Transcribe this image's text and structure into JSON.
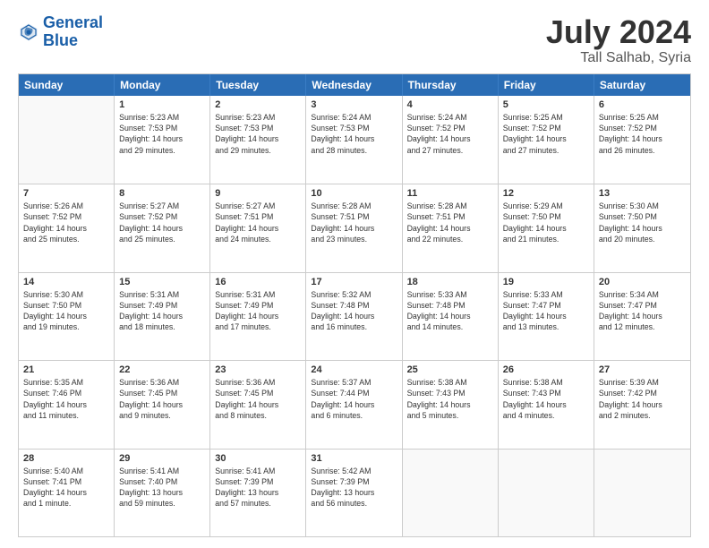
{
  "header": {
    "logo_line1": "General",
    "logo_line2": "Blue",
    "month_year": "July 2024",
    "location": "Tall Salhab, Syria"
  },
  "weekdays": [
    "Sunday",
    "Monday",
    "Tuesday",
    "Wednesday",
    "Thursday",
    "Friday",
    "Saturday"
  ],
  "weeks": [
    [
      {
        "day": "",
        "info": ""
      },
      {
        "day": "1",
        "info": "Sunrise: 5:23 AM\nSunset: 7:53 PM\nDaylight: 14 hours\nand 29 minutes."
      },
      {
        "day": "2",
        "info": "Sunrise: 5:23 AM\nSunset: 7:53 PM\nDaylight: 14 hours\nand 29 minutes."
      },
      {
        "day": "3",
        "info": "Sunrise: 5:24 AM\nSunset: 7:53 PM\nDaylight: 14 hours\nand 28 minutes."
      },
      {
        "day": "4",
        "info": "Sunrise: 5:24 AM\nSunset: 7:52 PM\nDaylight: 14 hours\nand 27 minutes."
      },
      {
        "day": "5",
        "info": "Sunrise: 5:25 AM\nSunset: 7:52 PM\nDaylight: 14 hours\nand 27 minutes."
      },
      {
        "day": "6",
        "info": "Sunrise: 5:25 AM\nSunset: 7:52 PM\nDaylight: 14 hours\nand 26 minutes."
      }
    ],
    [
      {
        "day": "7",
        "info": "Sunrise: 5:26 AM\nSunset: 7:52 PM\nDaylight: 14 hours\nand 25 minutes."
      },
      {
        "day": "8",
        "info": "Sunrise: 5:27 AM\nSunset: 7:52 PM\nDaylight: 14 hours\nand 25 minutes."
      },
      {
        "day": "9",
        "info": "Sunrise: 5:27 AM\nSunset: 7:51 PM\nDaylight: 14 hours\nand 24 minutes."
      },
      {
        "day": "10",
        "info": "Sunrise: 5:28 AM\nSunset: 7:51 PM\nDaylight: 14 hours\nand 23 minutes."
      },
      {
        "day": "11",
        "info": "Sunrise: 5:28 AM\nSunset: 7:51 PM\nDaylight: 14 hours\nand 22 minutes."
      },
      {
        "day": "12",
        "info": "Sunrise: 5:29 AM\nSunset: 7:50 PM\nDaylight: 14 hours\nand 21 minutes."
      },
      {
        "day": "13",
        "info": "Sunrise: 5:30 AM\nSunset: 7:50 PM\nDaylight: 14 hours\nand 20 minutes."
      }
    ],
    [
      {
        "day": "14",
        "info": "Sunrise: 5:30 AM\nSunset: 7:50 PM\nDaylight: 14 hours\nand 19 minutes."
      },
      {
        "day": "15",
        "info": "Sunrise: 5:31 AM\nSunset: 7:49 PM\nDaylight: 14 hours\nand 18 minutes."
      },
      {
        "day": "16",
        "info": "Sunrise: 5:31 AM\nSunset: 7:49 PM\nDaylight: 14 hours\nand 17 minutes."
      },
      {
        "day": "17",
        "info": "Sunrise: 5:32 AM\nSunset: 7:48 PM\nDaylight: 14 hours\nand 16 minutes."
      },
      {
        "day": "18",
        "info": "Sunrise: 5:33 AM\nSunset: 7:48 PM\nDaylight: 14 hours\nand 14 minutes."
      },
      {
        "day": "19",
        "info": "Sunrise: 5:33 AM\nSunset: 7:47 PM\nDaylight: 14 hours\nand 13 minutes."
      },
      {
        "day": "20",
        "info": "Sunrise: 5:34 AM\nSunset: 7:47 PM\nDaylight: 14 hours\nand 12 minutes."
      }
    ],
    [
      {
        "day": "21",
        "info": "Sunrise: 5:35 AM\nSunset: 7:46 PM\nDaylight: 14 hours\nand 11 minutes."
      },
      {
        "day": "22",
        "info": "Sunrise: 5:36 AM\nSunset: 7:45 PM\nDaylight: 14 hours\nand 9 minutes."
      },
      {
        "day": "23",
        "info": "Sunrise: 5:36 AM\nSunset: 7:45 PM\nDaylight: 14 hours\nand 8 minutes."
      },
      {
        "day": "24",
        "info": "Sunrise: 5:37 AM\nSunset: 7:44 PM\nDaylight: 14 hours\nand 6 minutes."
      },
      {
        "day": "25",
        "info": "Sunrise: 5:38 AM\nSunset: 7:43 PM\nDaylight: 14 hours\nand 5 minutes."
      },
      {
        "day": "26",
        "info": "Sunrise: 5:38 AM\nSunset: 7:43 PM\nDaylight: 14 hours\nand 4 minutes."
      },
      {
        "day": "27",
        "info": "Sunrise: 5:39 AM\nSunset: 7:42 PM\nDaylight: 14 hours\nand 2 minutes."
      }
    ],
    [
      {
        "day": "28",
        "info": "Sunrise: 5:40 AM\nSunset: 7:41 PM\nDaylight: 14 hours\nand 1 minute."
      },
      {
        "day": "29",
        "info": "Sunrise: 5:41 AM\nSunset: 7:40 PM\nDaylight: 13 hours\nand 59 minutes."
      },
      {
        "day": "30",
        "info": "Sunrise: 5:41 AM\nSunset: 7:39 PM\nDaylight: 13 hours\nand 57 minutes."
      },
      {
        "day": "31",
        "info": "Sunrise: 5:42 AM\nSunset: 7:39 PM\nDaylight: 13 hours\nand 56 minutes."
      },
      {
        "day": "",
        "info": ""
      },
      {
        "day": "",
        "info": ""
      },
      {
        "day": "",
        "info": ""
      }
    ]
  ]
}
